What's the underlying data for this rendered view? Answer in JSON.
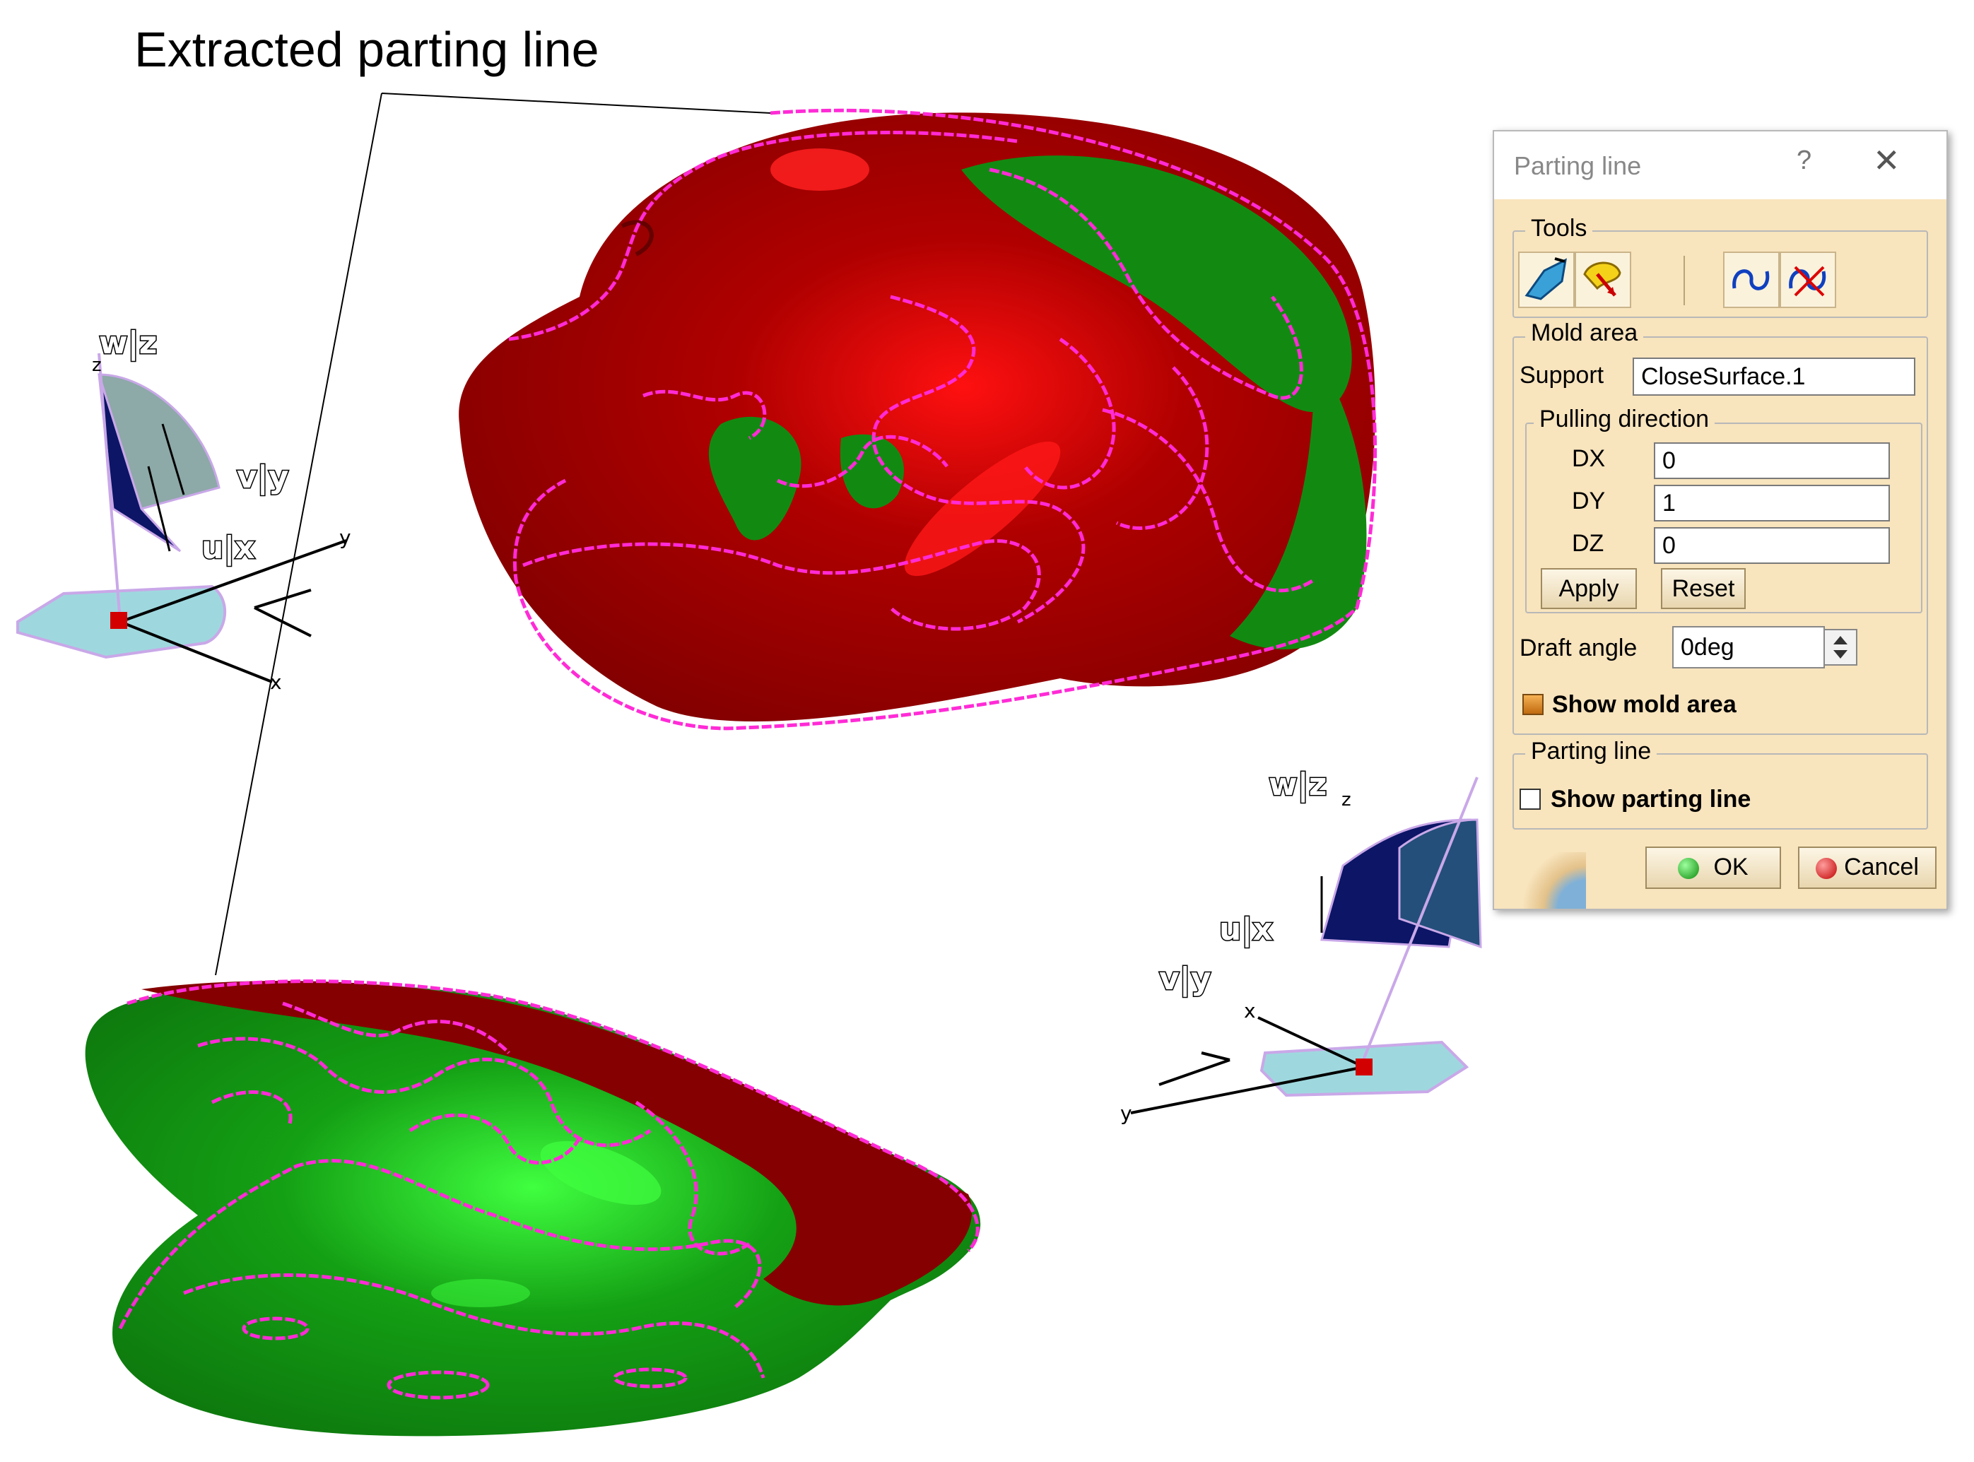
{
  "caption": "Extracted parting line",
  "axes_top": {
    "w_label": "w|z",
    "v_label": "v|y",
    "u_label": "u|x",
    "axis_z": "z",
    "axis_y": "y",
    "axis_x": "x"
  },
  "axes_bottom": {
    "w_label": "w|z",
    "v_label": "v|y",
    "u_label": "u|x",
    "axis_z": "z",
    "axis_y": "y",
    "axis_x": "x"
  },
  "colors": {
    "mold_red": "#8b0000",
    "mold_green": "#118a11",
    "parting_line": "#ff2bd6",
    "dialog_bg": "#f8e4bd"
  },
  "dialog": {
    "title": "Parting line",
    "help_icon": "?",
    "close_icon": "✕",
    "tools": {
      "legend": "Tools",
      "icons": [
        "surface-tool-icon",
        "pulling-direction-icon",
        "curve-icon",
        "cut-curve-icon"
      ]
    },
    "mold_area": {
      "legend": "Mold area",
      "support_label": "Support",
      "support_value": "CloseSurface.1",
      "pulling_direction": {
        "legend": "Pulling direction",
        "dx_label": "DX",
        "dx_value": "0",
        "dy_label": "DY",
        "dy_value": "1",
        "dz_label": "DZ",
        "dz_value": "0",
        "apply_label": "Apply",
        "reset_label": "Reset"
      },
      "draft_angle_label": "Draft angle",
      "draft_angle_value": "0deg",
      "show_mold_area_label": "Show mold area",
      "show_mold_area_checked": true
    },
    "parting_line": {
      "legend": "Parting line",
      "show_parting_line_label": "Show parting line",
      "show_parting_line_checked": false
    },
    "ok_label": "OK",
    "cancel_label": "Cancel"
  }
}
